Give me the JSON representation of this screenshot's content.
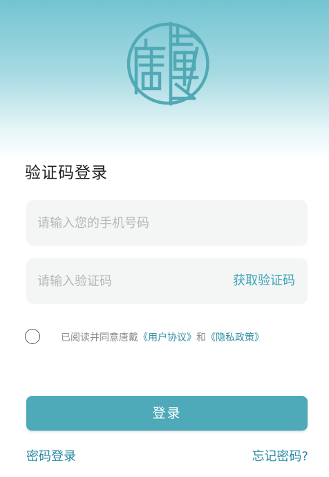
{
  "brand": {
    "logo_text": "唐戴",
    "logo_color": "#52a9b6"
  },
  "login": {
    "title": "验证码登录",
    "phone_placeholder": "请输入您的手机号码",
    "code_placeholder": "请输入验证码",
    "get_code_label": "获取验证码",
    "agreement": {
      "prefix": "已阅读并同意唐戴",
      "user_agreement": "《用户协议》",
      "conjunction": "和",
      "privacy_policy": "《隐私政策》",
      "checked": false
    },
    "submit_label": "登录",
    "password_login_label": "密码登录",
    "forgot_password_label": "忘记密码?"
  },
  "colors": {
    "accent": "#4ea9b8",
    "link": "#2a87a0",
    "header_gradient_top": "#72c4d1"
  }
}
